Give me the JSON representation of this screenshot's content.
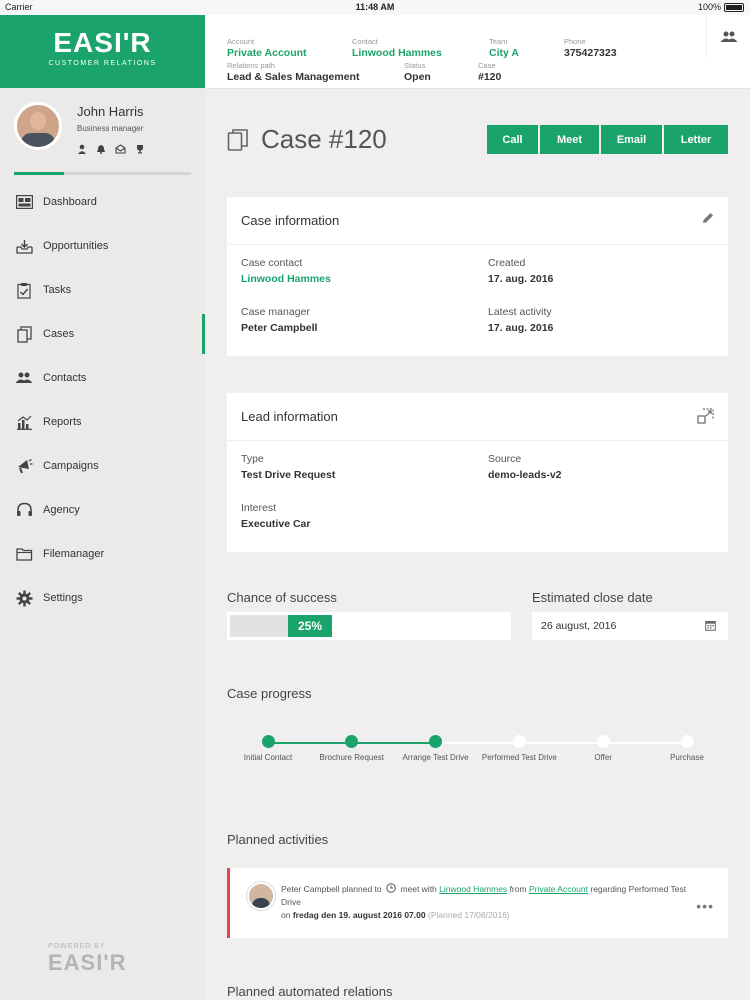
{
  "status_bar": {
    "carrier": "Carrier",
    "time": "11:48 AM",
    "battery": "100%"
  },
  "brand": {
    "logo": "EASI'R",
    "tagline": "CUSTOMER RELATIONS"
  },
  "profile": {
    "name": "John Harris",
    "role": "Business manager",
    "progress": 0.28
  },
  "nav": [
    {
      "label": "Dashboard",
      "icon": "dashboard-icon"
    },
    {
      "label": "Opportunities",
      "icon": "inbox-icon"
    },
    {
      "label": "Tasks",
      "icon": "clipboard-icon"
    },
    {
      "label": "Cases",
      "icon": "files-icon",
      "active": true
    },
    {
      "label": "Contacts",
      "icon": "people-icon"
    },
    {
      "label": "Reports",
      "icon": "chart-icon"
    },
    {
      "label": "Campaigns",
      "icon": "megaphone-icon"
    },
    {
      "label": "Agency",
      "icon": "headset-icon"
    },
    {
      "label": "Filemanager",
      "icon": "folder-icon"
    },
    {
      "label": "Settings",
      "icon": "gear-icon"
    }
  ],
  "powered": {
    "small": "POWERED BY",
    "big": "EASI'R"
  },
  "header": {
    "account_label": "Account",
    "account": "Private Account",
    "contact_label": "Contact",
    "contact": "Linwood Hammes",
    "team_label": "Team",
    "team": "City A",
    "phone_label": "Phone",
    "phone": "375427323",
    "path_label": "Relations path",
    "path": "Lead & Sales Management",
    "status_label": "Status",
    "status": "Open",
    "case_label": "Case",
    "case": "#120"
  },
  "case": {
    "title": "Case #120"
  },
  "actions": {
    "call": "Call",
    "meet": "Meet",
    "email": "Email",
    "letter": "Letter"
  },
  "case_info": {
    "title": "Case information",
    "contact_label": "Case contact",
    "contact": "Linwood Hammes",
    "created_label": "Created",
    "created": "17. aug. 2016",
    "manager_label": "Case manager",
    "manager": "Peter Campbell",
    "activity_label": "Latest activity",
    "activity": "17. aug. 2016"
  },
  "lead_info": {
    "title": "Lead information",
    "type_label": "Type",
    "type": "Test Drive Request",
    "source_label": "Source",
    "source": "demo-leads-v2",
    "interest_label": "Interest",
    "interest": "Executive Car"
  },
  "success": {
    "label": "Chance of success",
    "value": "25%",
    "fraction": 0.25
  },
  "close_date": {
    "label": "Estimated close date",
    "value": "26 august, 2016"
  },
  "progress": {
    "label": "Case progress",
    "steps": [
      {
        "label": "Initial Contact",
        "done": true
      },
      {
        "label": "Brochure Request",
        "done": true
      },
      {
        "label": "Arrange Test Drive",
        "done": true
      },
      {
        "label": "Performed Test Drive",
        "done": false
      },
      {
        "label": "Offer",
        "done": false
      },
      {
        "label": "Purchase",
        "done": false
      }
    ]
  },
  "planned": {
    "label": "Planned activities",
    "item": {
      "who": "Peter Campbell planned to",
      "action": "meet with",
      "contact": "Linwood Hammes",
      "from": "from",
      "account": "Private Account",
      "regarding": "regarding Performed Test Drive",
      "on": "on",
      "when": "fredag den 19. august 2016 07.00",
      "planned": "(Planned 17/08/2016)"
    }
  },
  "automated": {
    "label": "Planned automated relations"
  },
  "colors": {
    "accent": "#1aa36b",
    "alert": "#e0484e"
  }
}
